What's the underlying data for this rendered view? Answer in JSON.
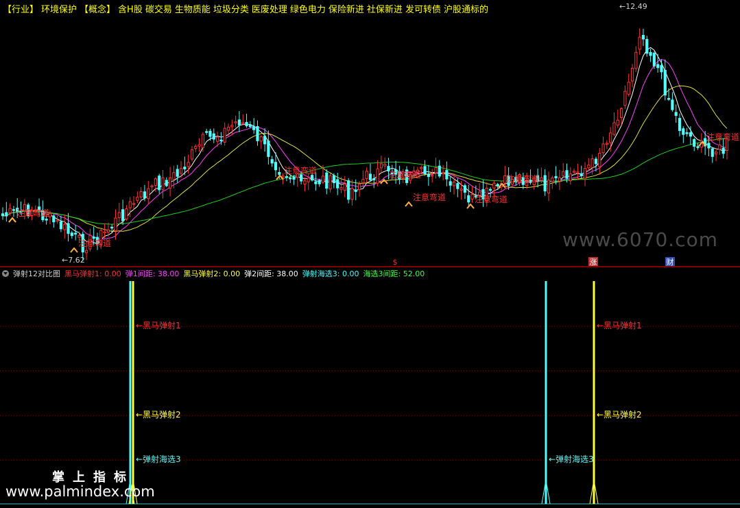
{
  "header": {
    "tags": [
      "【行业】",
      "环境保护",
      "【概念】",
      "含H股",
      "碳交易",
      "生物质能",
      "垃圾分类",
      "医废处理",
      "绿色电力",
      "保险新进",
      "社保新进",
      "发可转债",
      "沪股通标的"
    ]
  },
  "price_chart": {
    "high_label": "12.49",
    "low_label": "7.62",
    "signal_label": "注意弯道",
    "event_markers": [
      {
        "text": "$",
        "color": "#ff3030",
        "bg": "none"
      },
      {
        "text": "涨",
        "color": "#ffffff",
        "bg": "#c03030"
      },
      {
        "text": "财",
        "color": "#ffffff",
        "bg": "#3050c0"
      }
    ]
  },
  "indicator": {
    "name": "弹射12对比图",
    "values": [
      {
        "label": "黑马弹射1",
        "value": "0.00",
        "color": "#ff3030"
      },
      {
        "label": "弹1间距",
        "value": "38.00",
        "color": "#ff40ff"
      },
      {
        "label": "黑马弹射2",
        "value": "0.00",
        "color": "#ffff40"
      },
      {
        "label": "弹2间距",
        "value": "38.00",
        "color": "#ffffff"
      },
      {
        "label": "弹射海选3",
        "value": "0.00",
        "color": "#40ffff"
      },
      {
        "label": "海选3间距",
        "value": "52.00",
        "color": "#40ff40"
      }
    ],
    "annotations": [
      "←黑马弹射1",
      "←黑马弹射2",
      "←弹射海选3"
    ]
  },
  "watermarks": {
    "site1": "www.6070.com",
    "cn": "掌上指标",
    "site2": "www.palmindex.com"
  },
  "colors": {
    "up": "#ff3232",
    "down": "#54fcfc",
    "ma_white": "#ffffff",
    "ma_magenta": "#ff40ff",
    "ma_yellow": "#e0e040",
    "ma_green": "#20d020",
    "signal": "#ff3030",
    "grid": "#8b0000"
  },
  "chart_data": {
    "type": "candlestick",
    "price_range": [
      7.62,
      12.49
    ],
    "signal_count": 9,
    "spike_events": [
      {
        "name": "黑马弹射1",
        "color": "#ffff40"
      },
      {
        "name": "黑马弹射2",
        "color": "#ffff40"
      },
      {
        "name": "弹射海选3",
        "color": "#54fcfc"
      }
    ]
  }
}
